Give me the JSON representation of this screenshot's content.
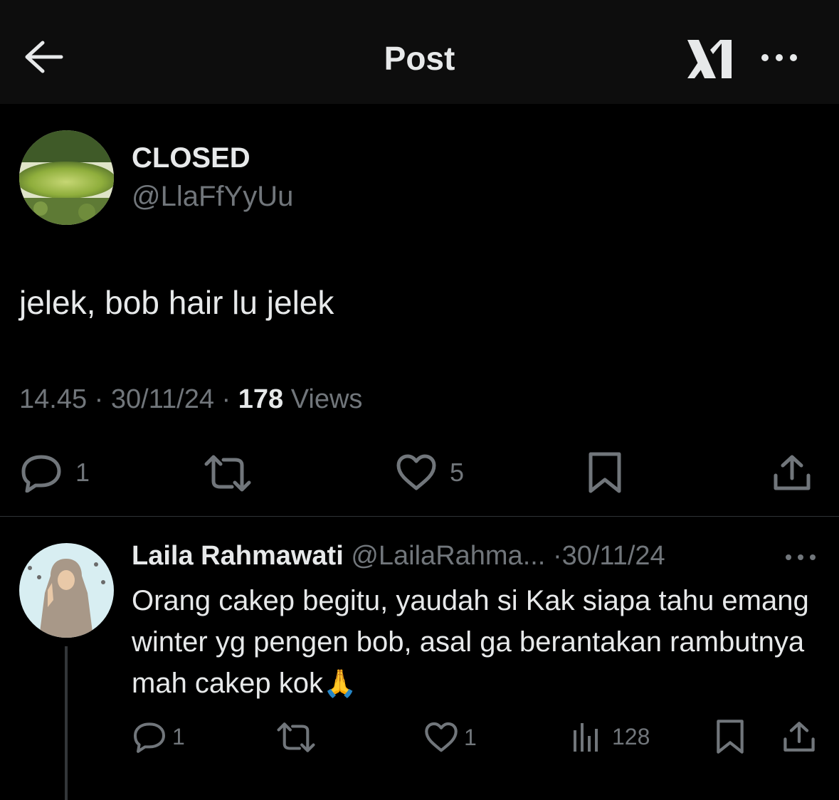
{
  "header": {
    "title": "Post",
    "back_icon": "arrow-left-icon",
    "logo_icon": "x-logo-icon",
    "more_icon": "more-horizontal-icon"
  },
  "post": {
    "display_name": "CLOSED",
    "handle": "@LlaFfYyUu",
    "text": "jelek, bob hair lu jelek",
    "time": "14.45",
    "date": "30/11/24",
    "views_count": "178",
    "views_label": "Views",
    "actions": {
      "replies": "1",
      "likes": "5"
    }
  },
  "reply": {
    "display_name": "Laila Rahmawati",
    "handle": "@LailaRahma...",
    "date": "30/11/24",
    "text": "Orang cakep begitu, yaudah si Kak siapa tahu emang winter yg pengen bob, asal ga berantakan rambutnya mah cakep kok",
    "emoji": "🙏",
    "actions": {
      "replies": "1",
      "likes": "1",
      "views": "128"
    }
  },
  "colors": {
    "background": "#000000",
    "header": "#0d0d0d",
    "text": "#e7e9ea",
    "muted": "#71767b",
    "divider": "#2f3336"
  }
}
